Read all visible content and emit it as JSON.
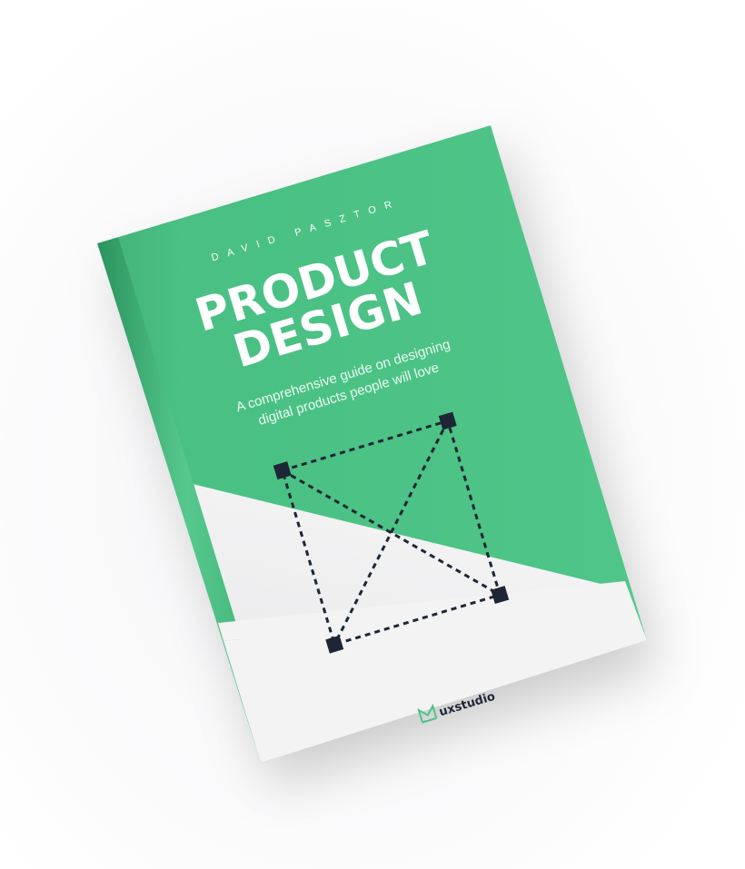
{
  "cover": {
    "author": "DAVID PASZTOR",
    "title_line1": "PRODUCT",
    "title_line2": "DESIGN",
    "subtitle_line1": "A comprehensive guide on designing",
    "subtitle_line2": "digital products people will love",
    "publisher": "uxstudio"
  },
  "colors": {
    "cover_green": "#4bc486",
    "spine_green": "#3db378",
    "footer_white": "#f3f3f4",
    "dark_navy": "#1e2635"
  },
  "icons": {
    "publisher_logo": "uxstudio-logo-icon",
    "wireframe": "wireframe-placeholder-icon"
  }
}
